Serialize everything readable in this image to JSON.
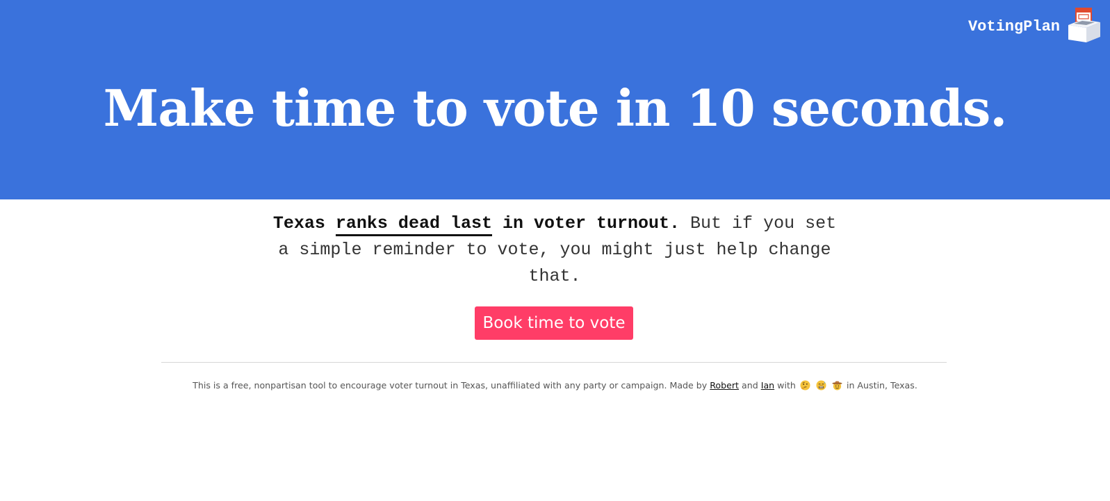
{
  "header": {
    "brand_name": "VotingPlan",
    "brand_logo_icon": "ballot-box-calendar-icon"
  },
  "hero": {
    "headline": "Make time to vote in 10 seconds.",
    "background_color": "#3a72dc"
  },
  "intro": {
    "state": "Texas",
    "rank_link_text": "ranks dead last",
    "bold_tail": "in voter turnout.",
    "body": "But if you set a simple reminder to vote, you might just help change that."
  },
  "cta": {
    "label": "Book time to vote",
    "color": "#ff3d67"
  },
  "footer": {
    "text_before": "This is a free, nonpartisan tool to encourage voter turnout in Texas, unaffiliated with any party or campaign. Made by",
    "author1": "Robert",
    "and": "and",
    "author2": "Ian",
    "with": "with",
    "emojis": [
      "thinking-face-icon",
      "grimacing-sweat-face-icon",
      "cowboy-face-icon"
    ],
    "text_after": "in Austin, Texas."
  }
}
